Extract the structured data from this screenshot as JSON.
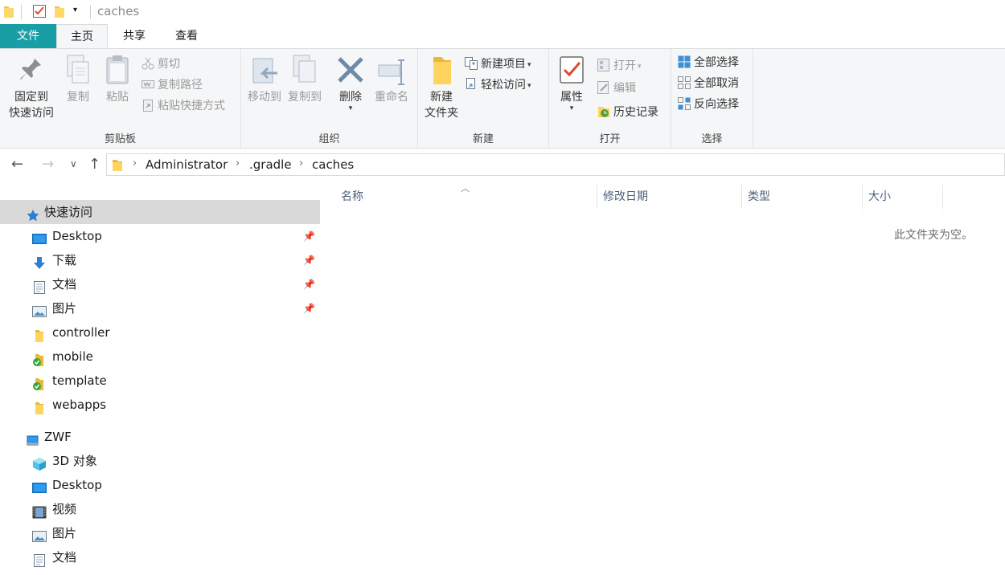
{
  "window": {
    "title": "caches"
  },
  "ribbon_tabs": {
    "file": "文件",
    "home": "主页",
    "share": "共享",
    "view": "查看"
  },
  "clipboard": {
    "pin": "固定到\n快速访问",
    "pin_l1": "固定到",
    "pin_l2": "快速访问",
    "copy": "复制",
    "paste": "粘贴",
    "cut": "剪切",
    "copy_path": "复制路径",
    "paste_shortcut": "粘贴快捷方式",
    "label": "剪贴板"
  },
  "organize": {
    "move_to": "移动到",
    "copy_to": "复制到",
    "delete": "删除",
    "rename": "重命名",
    "label": "组织"
  },
  "new": {
    "new_folder_l1": "新建",
    "new_folder_l2": "文件夹",
    "new_item": "新建项目",
    "easy_access": "轻松访问",
    "label": "新建"
  },
  "open": {
    "properties": "属性",
    "open": "打开",
    "edit": "编辑",
    "history": "历史记录",
    "label": "打开"
  },
  "select": {
    "select_all": "全部选择",
    "select_none": "全部取消",
    "invert": "反向选择",
    "label": "选择"
  },
  "address": {
    "crumbs": [
      "Administrator",
      ".gradle",
      "caches"
    ]
  },
  "nav": {
    "quick_access": "快速访问",
    "items": [
      "Desktop",
      "下载",
      "文档",
      "图片",
      "controller",
      "mobile",
      "template",
      "webapps"
    ],
    "pc": "ZWF",
    "pc_items": [
      "3D 对象",
      "Desktop",
      "视频",
      "图片",
      "文档"
    ]
  },
  "columns": {
    "name": "名称",
    "modified": "修改日期",
    "type": "类型",
    "size": "大小"
  },
  "empty_message": "此文件夹为空。",
  "colors": {
    "file_tab": "#1a9ea6",
    "selected": "#d9d9d9",
    "ribbon_bg": "#f5f6f7",
    "header_text": "#4c607a"
  }
}
